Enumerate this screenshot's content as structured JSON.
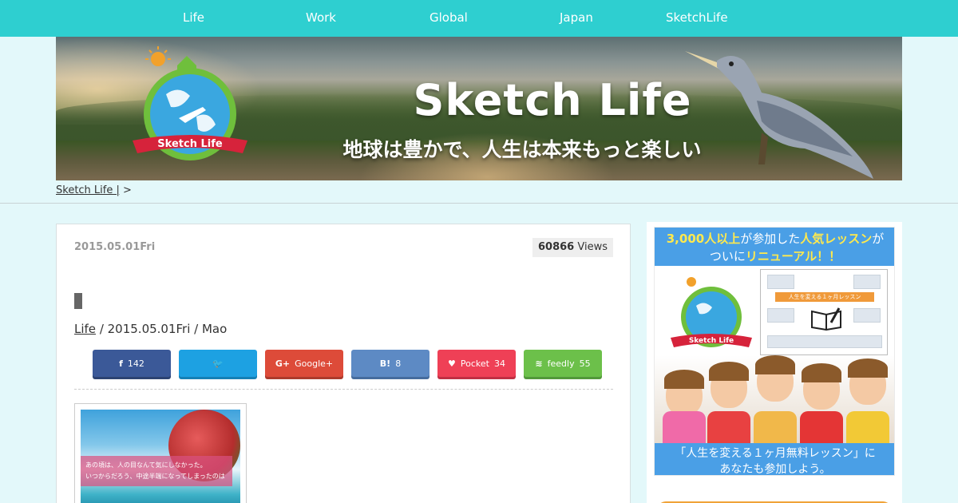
{
  "nav": {
    "items": [
      "Life",
      "Work",
      "Global",
      "Japan",
      "SketchLife"
    ]
  },
  "banner": {
    "title": "Sketch Life",
    "subtitle": "地球は豊かで、人生は本来もっと楽しい",
    "logo_text": "Sketch Life"
  },
  "breadcrumb": {
    "home": "Sketch Life |",
    "separator": ">"
  },
  "article": {
    "date": "2015.05.01Fri",
    "views_count": "60866",
    "views_label": "Views",
    "meta_category": "Life",
    "meta_rest": " / 2015.05.01Fri / Mao",
    "thumb_line1": "あの頃は、人の目なんて気にしなかった。",
    "thumb_line2": "いつからだろう、中途半端になってしまったのは"
  },
  "share": {
    "facebook": {
      "icon": "f",
      "count": "142"
    },
    "twitter": {
      "icon": "🐦"
    },
    "googleplus": {
      "icon": "G+",
      "label": "Google+"
    },
    "hatena": {
      "icon": "B!",
      "count": "8"
    },
    "pocket": {
      "icon": "♥",
      "label": "Pocket",
      "count": "34"
    },
    "feedly": {
      "icon": "≋",
      "label": "feedly",
      "count": "55"
    }
  },
  "sidebar": {
    "ad": {
      "head_highlight1": "3,000人以上",
      "head_text1": "が参加した",
      "head_highlight2": "人気レッスン",
      "head_text2": "が",
      "head_text3": "ついに",
      "head_highlight3": "リニューアル！！",
      "shot_bar": "人生を変える１ヶ月レッスン",
      "logo_text": "Sketch Life",
      "foot_line1": "「人生を変える１ヶ月無料レッスン」に",
      "foot_line2": "あなたも参加しよう。"
    }
  },
  "colors": {
    "nav_bg": "#2ecfd0",
    "page_bg": "#e3f8fa",
    "ad_blue": "#4a9fe6",
    "facebook": "#3b5998",
    "twitter": "#1da1e2",
    "googleplus": "#dd4b39",
    "hatena": "#5d8ac4",
    "pocket": "#ef4056",
    "feedly": "#6cc04a"
  }
}
